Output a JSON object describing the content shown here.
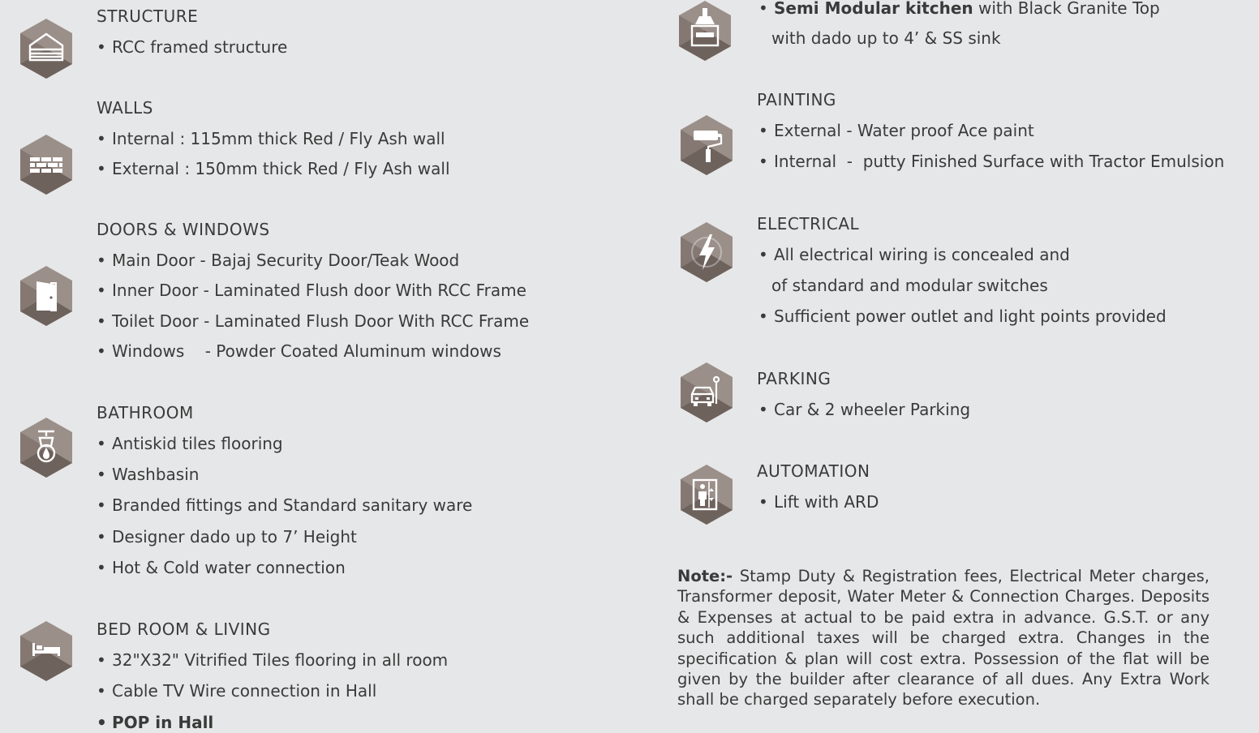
{
  "colors": {
    "background": "#e6e7e8",
    "hex_light": "#9b8f8a",
    "hex_dark": "#6e625d",
    "text": "#3a3a3a"
  },
  "left": {
    "structure": {
      "title": "STRUCTURE",
      "icon": "building-icon",
      "items": [
        "RCC framed structure"
      ]
    },
    "walls": {
      "title": "WALLS",
      "icon": "brick-wall-icon",
      "items": [
        "Internal : 115mm thick Red / Fly Ash wall",
        "External : 150mm thick Red / Fly Ash wall"
      ]
    },
    "doors": {
      "title": "DOORS & WINDOWS",
      "icon": "door-icon",
      "items": [
        "Main Door - Bajaj Security Door/Teak Wood",
        "Inner Door - Laminated Flush door With RCC Frame",
        "Toilet Door - Laminated Flush Door With RCC Frame",
        "Windows    - Powder Coated Aluminum windows"
      ]
    },
    "bathroom": {
      "title": "BATHROOM",
      "icon": "shower-tap-icon",
      "items": [
        "Antiskid tiles flooring",
        "Washbasin",
        "Branded fittings and Standard sanitary ware",
        "Designer dado up to 7’ Height",
        "Hot & Cold water connection"
      ]
    },
    "bedroom": {
      "title": "BED ROOM & LIVING",
      "icon": "bed-icon",
      "items": [
        "32\"X32\" Vitrified Tiles flooring in all room",
        "Cable TV Wire connection in Hall",
        "POP in Hall"
      ]
    }
  },
  "right": {
    "kitchen": {
      "icon": "kitchen-hood-icon",
      "bold": "Semi Modular kitchen",
      "rest": " with Black Granite Top",
      "line2": "with dado up to 4’ & SS sink"
    },
    "painting": {
      "title": "PAINTING",
      "icon": "paint-roller-icon",
      "items": [
        "External - Water proof Ace paint",
        "Internal  -  putty Finished Surface with Tractor Emulsion"
      ]
    },
    "electrical": {
      "title": "ELECTRICAL",
      "icon": "lightning-icon",
      "items": [
        "All electrical wiring is concealed and",
        "of standard and modular switches",
        "Sufficient power outlet and light points provided"
      ]
    },
    "parking": {
      "title": "PARKING",
      "icon": "car-icon",
      "items": [
        "Car & 2 wheeler Parking"
      ]
    },
    "automation": {
      "title": "AUTOMATION",
      "icon": "lift-icon",
      "items": [
        "Lift with ARD"
      ]
    }
  },
  "note": {
    "label": "Note:-",
    "text": " Stamp Duty & Registration fees, Electrical Meter charges, Transformer deposit, Water Meter & Connection Charges. Deposits & Expenses at actual to be paid extra in advance. G.S.T. or any such additional taxes will be charged extra. Changes in the specification  & plan will cost extra. Possession of the flat will be given by the builder after clearance of all dues. Any Extra Work shall be charged separately before execution."
  }
}
